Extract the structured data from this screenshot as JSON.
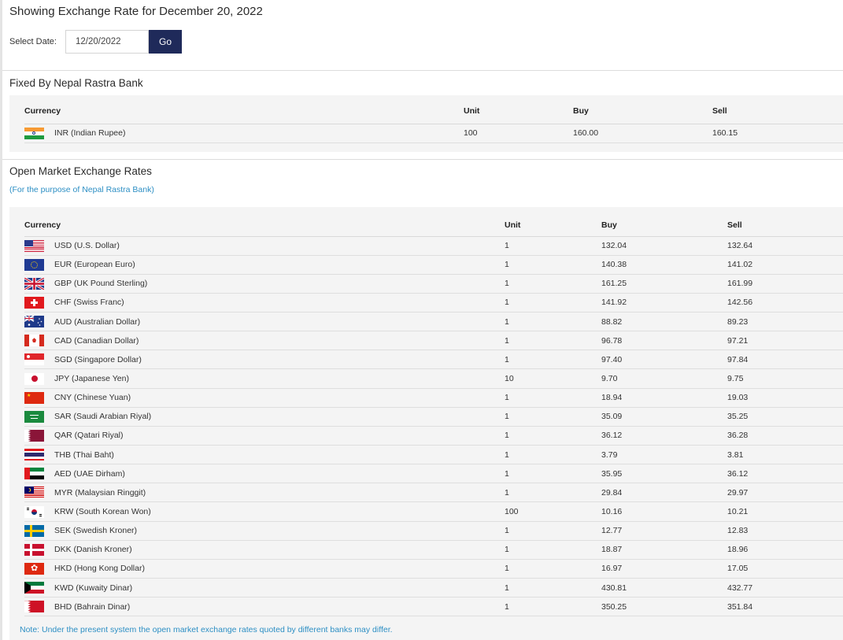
{
  "page_title": "Showing Exchange Rate for December 20, 2022",
  "date_form": {
    "label": "Select Date:",
    "value": "12/20/2022",
    "button": "Go"
  },
  "fixed": {
    "title": "Fixed By Nepal Rastra Bank",
    "headers": {
      "currency": "Currency",
      "unit": "Unit",
      "buy": "Buy",
      "sell": "Sell"
    },
    "rows": [
      {
        "flag": "india-flag-icon",
        "currency": "INR (Indian Rupee)",
        "unit": "100",
        "buy": "160.00",
        "sell": "160.15"
      }
    ]
  },
  "open_market": {
    "title": "Open Market Exchange Rates",
    "subtitle": "(For the purpose of Nepal Rastra Bank)",
    "headers": {
      "currency": "Currency",
      "unit": "Unit",
      "buy": "Buy",
      "sell": "Sell"
    },
    "rows": [
      {
        "flag": "usa-flag-icon",
        "currency": "USD (U.S. Dollar)",
        "unit": "1",
        "buy": "132.04",
        "sell": "132.64"
      },
      {
        "flag": "eu-flag-icon",
        "currency": "EUR (European Euro)",
        "unit": "1",
        "buy": "140.38",
        "sell": "141.02"
      },
      {
        "flag": "uk-flag-icon",
        "currency": "GBP (UK Pound Sterling)",
        "unit": "1",
        "buy": "161.25",
        "sell": "161.99"
      },
      {
        "flag": "switzerland-flag-icon",
        "currency": "CHF (Swiss Franc)",
        "unit": "1",
        "buy": "141.92",
        "sell": "142.56"
      },
      {
        "flag": "australia-flag-icon",
        "currency": "AUD (Australian Dollar)",
        "unit": "1",
        "buy": "88.82",
        "sell": "89.23"
      },
      {
        "flag": "canada-flag-icon",
        "currency": "CAD (Canadian Dollar)",
        "unit": "1",
        "buy": "96.78",
        "sell": "97.21"
      },
      {
        "flag": "singapore-flag-icon",
        "currency": "SGD (Singapore Dollar)",
        "unit": "1",
        "buy": "97.40",
        "sell": "97.84"
      },
      {
        "flag": "japan-flag-icon",
        "currency": "JPY (Japanese Yen)",
        "unit": "10",
        "buy": "9.70",
        "sell": "9.75"
      },
      {
        "flag": "china-flag-icon",
        "currency": "CNY (Chinese Yuan)",
        "unit": "1",
        "buy": "18.94",
        "sell": "19.03"
      },
      {
        "flag": "saudi-arabia-flag-icon",
        "currency": "SAR (Saudi Arabian Riyal)",
        "unit": "1",
        "buy": "35.09",
        "sell": "35.25"
      },
      {
        "flag": "qatar-flag-icon",
        "currency": "QAR (Qatari Riyal)",
        "unit": "1",
        "buy": "36.12",
        "sell": "36.28"
      },
      {
        "flag": "thailand-flag-icon",
        "currency": "THB (Thai Baht)",
        "unit": "1",
        "buy": "3.79",
        "sell": "3.81"
      },
      {
        "flag": "uae-flag-icon",
        "currency": "AED (UAE Dirham)",
        "unit": "1",
        "buy": "35.95",
        "sell": "36.12"
      },
      {
        "flag": "malaysia-flag-icon",
        "currency": "MYR (Malaysian Ringgit)",
        "unit": "1",
        "buy": "29.84",
        "sell": "29.97"
      },
      {
        "flag": "south-korea-flag-icon",
        "currency": "KRW (South Korean Won)",
        "unit": "100",
        "buy": "10.16",
        "sell": "10.21"
      },
      {
        "flag": "sweden-flag-icon",
        "currency": "SEK (Swedish Kroner)",
        "unit": "1",
        "buy": "12.77",
        "sell": "12.83"
      },
      {
        "flag": "denmark-flag-icon",
        "currency": "DKK (Danish Kroner)",
        "unit": "1",
        "buy": "18.87",
        "sell": "18.96"
      },
      {
        "flag": "hong-kong-flag-icon",
        "currency": "HKD (Hong Kong Dollar)",
        "unit": "1",
        "buy": "16.97",
        "sell": "17.05"
      },
      {
        "flag": "kuwait-flag-icon",
        "currency": "KWD (Kuwaity Dinar)",
        "unit": "1",
        "buy": "430.81",
        "sell": "432.77"
      },
      {
        "flag": "bahrain-flag-icon",
        "currency": "BHD (Bahrain Dinar)",
        "unit": "1",
        "buy": "350.25",
        "sell": "351.84"
      }
    ],
    "note": "Note: Under the present system the open market exchange rates quoted by different banks may differ."
  }
}
